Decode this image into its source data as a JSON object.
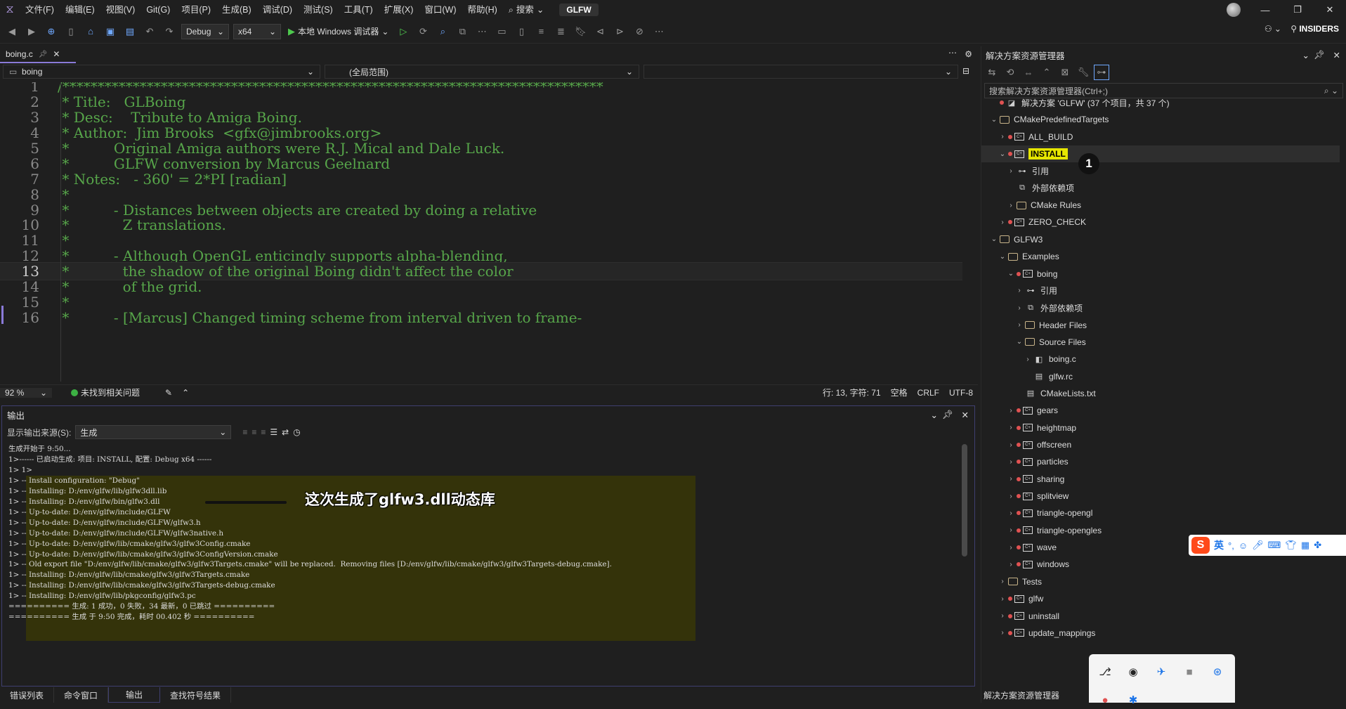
{
  "menubar": {
    "items": [
      "文件(F)",
      "编辑(E)",
      "视图(V)",
      "Git(G)",
      "项目(P)",
      "生成(B)",
      "调试(D)",
      "测试(S)",
      "工具(T)",
      "扩展(X)",
      "窗口(W)",
      "帮助(H)"
    ],
    "search_label": "搜索",
    "solution_name": "GLFW",
    "insiders_label": "INSIDERS"
  },
  "toolbar": {
    "config": "Debug",
    "platform": "x64",
    "run_label": "本地 Windows 调试器"
  },
  "editor": {
    "tab_name": "boing.c",
    "nav_project": "boing",
    "nav_scope": "(全局范围)",
    "nav_member": "",
    "current_line": 13,
    "lines": [
      {
        "n": "1",
        "text": "/*****************************************************************************"
      },
      {
        "n": "2",
        "text": " * Title:   GLBoing"
      },
      {
        "n": "3",
        "text": " * Desc:    Tribute to Amiga Boing."
      },
      {
        "n": "4",
        "text": " * Author:  Jim Brooks  <gfx@jimbrooks.org>"
      },
      {
        "n": "5",
        "text": " *          Original Amiga authors were R.J. Mical and Dale Luck."
      },
      {
        "n": "6",
        "text": " *          GLFW conversion by Marcus Geelnard"
      },
      {
        "n": "7",
        "text": " * Notes:   - 360' = 2*PI [radian]"
      },
      {
        "n": "8",
        "text": " *"
      },
      {
        "n": "9",
        "text": " *          - Distances between objects are created by doing a relative"
      },
      {
        "n": "10",
        "text": " *            Z translations."
      },
      {
        "n": "11",
        "text": " *"
      },
      {
        "n": "12",
        "text": " *          - Although OpenGL enticingly supports alpha-blending,"
      },
      {
        "n": "13",
        "text": " *            the shadow of the original Boing didn't affect the color"
      },
      {
        "n": "14",
        "text": " *            of the grid."
      },
      {
        "n": "15",
        "text": " *"
      },
      {
        "n": "16",
        "text": " *          - [Marcus] Changed timing scheme from interval driven to frame-"
      }
    ]
  },
  "editor_status": {
    "zoom": "92 %",
    "issues": "未找到相关问题",
    "position": "行: 13, 字符: 71",
    "whitespace": "空格",
    "line_ending": "CRLF",
    "encoding": "UTF-8"
  },
  "output": {
    "title": "输出",
    "source_label": "显示输出来源(S):",
    "source_value": "生成",
    "lines": [
      "生成开始于 9:50...",
      "1>------ 已启动生成: 项目: INSTALL, 配置: Debug x64 ------",
      "1> 1>",
      "1> -- Install configuration: \"Debug\"",
      "1> -- Installing: D:/env/glfw/lib/glfw3dll.lib",
      "1> -- Installing: D:/env/glfw/bin/glfw3.dll",
      "1> -- Up-to-date: D:/env/glfw/include/GLFW",
      "1> -- Up-to-date: D:/env/glfw/include/GLFW/glfw3.h",
      "1> -- Up-to-date: D:/env/glfw/include/GLFW/glfw3native.h",
      "1> -- Up-to-date: D:/env/glfw/lib/cmake/glfw3/glfw3Config.cmake",
      "1> -- Up-to-date: D:/env/glfw/lib/cmake/glfw3/glfw3ConfigVersion.cmake",
      "1> -- Old export file \"D:/env/glfw/lib/cmake/glfw3/glfw3Targets.cmake\" will be replaced.  Removing files [D:/env/glfw/lib/cmake/glfw3/glfw3Targets-debug.cmake].",
      "1> -- Installing: D:/env/glfw/lib/cmake/glfw3/glfw3Targets.cmake",
      "1> -- Installing: D:/env/glfw/lib/cmake/glfw3/glfw3Targets-debug.cmake",
      "1> -- Installing: D:/env/glfw/lib/pkgconfig/glfw3.pc",
      "========== 生成: 1 成功，0 失败，34 最新，0 已跳过 ==========",
      "========== 生成 于 9:50 完成，耗时 00.402 秒 =========="
    ],
    "annotation": "这次生成了glfw3.dll动态库"
  },
  "bottom_tabs": [
    "错误列表",
    "命令窗口",
    "输出",
    "查找符号结果"
  ],
  "solution_explorer": {
    "title": "解决方案资源管理器",
    "search_placeholder": "搜索解决方案资源管理器(Ctrl+;)",
    "badge": "1",
    "footer": "解决方案资源管理器",
    "tree": [
      {
        "label": "解决方案 'GLFW' (37 个项目，共 37 个)",
        "depth": 0,
        "tw": "",
        "icon": "solution",
        "dot": true
      },
      {
        "label": "CMakePredefinedTargets",
        "depth": 0,
        "tw": "⌄",
        "icon": "folder",
        "dot": false
      },
      {
        "label": "ALL_BUILD",
        "depth": 1,
        "tw": "›",
        "icon": "proj",
        "dot": true
      },
      {
        "label": "INSTALL",
        "depth": 1,
        "tw": "⌄",
        "icon": "proj",
        "dot": true,
        "highlight": true
      },
      {
        "label": "引用",
        "depth": 2,
        "tw": "›",
        "icon": "ref",
        "dot": false
      },
      {
        "label": "外部依赖项",
        "depth": 2,
        "tw": "",
        "icon": "ext",
        "dot": false
      },
      {
        "label": "CMake Rules",
        "depth": 2,
        "tw": "›",
        "icon": "folder",
        "dot": false
      },
      {
        "label": "ZERO_CHECK",
        "depth": 1,
        "tw": "›",
        "icon": "proj",
        "dot": true
      },
      {
        "label": "GLFW3",
        "depth": 0,
        "tw": "⌄",
        "icon": "folder",
        "dot": false
      },
      {
        "label": "Examples",
        "depth": 1,
        "tw": "⌄",
        "icon": "folder",
        "dot": false
      },
      {
        "label": "boing",
        "depth": 2,
        "tw": "⌄",
        "icon": "proj",
        "dot": true
      },
      {
        "label": "引用",
        "depth": 3,
        "tw": "›",
        "icon": "ref",
        "dot": false
      },
      {
        "label": "外部依赖项",
        "depth": 3,
        "tw": "›",
        "icon": "ext",
        "dot": false
      },
      {
        "label": "Header Files",
        "depth": 3,
        "tw": "›",
        "icon": "folder",
        "dot": false
      },
      {
        "label": "Source Files",
        "depth": 3,
        "tw": "⌄",
        "icon": "folder",
        "dot": false
      },
      {
        "label": "boing.c",
        "depth": 4,
        "tw": "›",
        "icon": "cfile",
        "dot": false
      },
      {
        "label": "glfw.rc",
        "depth": 4,
        "tw": "",
        "icon": "rcfile",
        "dot": false
      },
      {
        "label": "CMakeLists.txt",
        "depth": 3,
        "tw": "",
        "icon": "txtfile",
        "dot": false
      },
      {
        "label": "gears",
        "depth": 2,
        "tw": "›",
        "icon": "proj",
        "dot": true
      },
      {
        "label": "heightmap",
        "depth": 2,
        "tw": "›",
        "icon": "proj",
        "dot": true
      },
      {
        "label": "offscreen",
        "depth": 2,
        "tw": "›",
        "icon": "proj",
        "dot": true
      },
      {
        "label": "particles",
        "depth": 2,
        "tw": "›",
        "icon": "proj",
        "dot": true
      },
      {
        "label": "sharing",
        "depth": 2,
        "tw": "›",
        "icon": "proj",
        "dot": true
      },
      {
        "label": "splitview",
        "depth": 2,
        "tw": "›",
        "icon": "proj",
        "dot": true
      },
      {
        "label": "triangle-opengl",
        "depth": 2,
        "tw": "›",
        "icon": "proj",
        "dot": true
      },
      {
        "label": "triangle-opengles",
        "depth": 2,
        "tw": "›",
        "icon": "proj",
        "dot": true
      },
      {
        "label": "wave",
        "depth": 2,
        "tw": "›",
        "icon": "proj",
        "dot": true
      },
      {
        "label": "windows",
        "depth": 2,
        "tw": "›",
        "icon": "proj",
        "dot": true
      },
      {
        "label": "Tests",
        "depth": 1,
        "tw": "›",
        "icon": "folder",
        "dot": false
      },
      {
        "label": "glfw",
        "depth": 1,
        "tw": "›",
        "icon": "proj",
        "dot": true
      },
      {
        "label": "uninstall",
        "depth": 1,
        "tw": "›",
        "icon": "proj",
        "dot": true
      },
      {
        "label": "update_mappings",
        "depth": 1,
        "tw": "›",
        "icon": "proj",
        "dot": true
      }
    ]
  },
  "ime": {
    "logo": "S",
    "mode": "英"
  }
}
